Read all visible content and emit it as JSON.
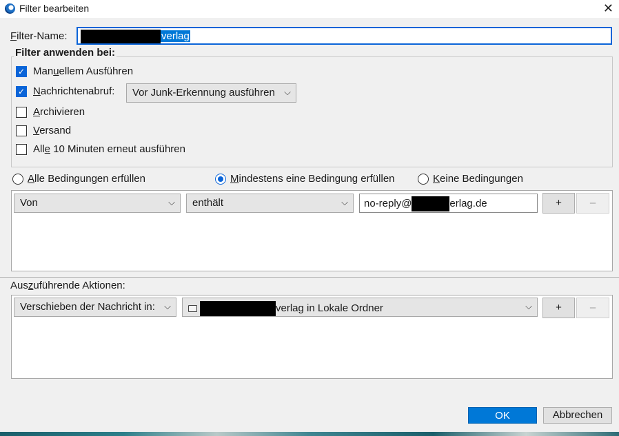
{
  "window": {
    "title": "Filter bearbeiten",
    "close_glyph": "✕"
  },
  "filter_name": {
    "label_prefix": "F",
    "label_rest": "ilter-Name:",
    "value_suffix": "verlag"
  },
  "apply_group": {
    "legend": "Filter anwenden bei:",
    "items": [
      {
        "pre": "Man",
        "acc": "u",
        "post": "ellem Ausführen",
        "checked": true
      },
      {
        "pre": "",
        "acc": "N",
        "post": "achrichtenabruf:",
        "checked": true
      },
      {
        "pre": "",
        "acc": "A",
        "post": "rchivieren",
        "checked": false
      },
      {
        "pre": "",
        "acc": "V",
        "post": "ersand",
        "checked": false
      },
      {
        "pre": "All",
        "acc": "e",
        "post": " 10 Minuten erneut ausführen",
        "checked": false
      }
    ],
    "junk_dropdown": "Vor Junk-Erkennung ausführen"
  },
  "match": {
    "options": [
      {
        "acc": "A",
        "rest": "lle Bedingungen erfüllen",
        "selected": false
      },
      {
        "acc": "M",
        "rest": "indestens eine Bedingung erfüllen",
        "selected": true
      },
      {
        "acc": "K",
        "rest": "eine Bedingungen",
        "selected": false
      }
    ]
  },
  "condition": {
    "field": "Von",
    "operator": "enthält",
    "value_prefix": "no-reply@",
    "value_suffix": "erlag.de",
    "add_label": "+",
    "remove_label": "–"
  },
  "actions": {
    "label_pre": "Aus",
    "label_acc": "z",
    "label_post": "uführende Aktionen:",
    "action": "Verschieben der Nachricht in:",
    "target_suffix": "verlag in Lokale Ordner",
    "add_label": "+",
    "remove_label": "–"
  },
  "footer": {
    "ok": "OK",
    "cancel": "Abbrechen"
  },
  "icons": {
    "app": "thunderbird-icon",
    "close": "close-icon",
    "chevron": "chevron-down-icon",
    "folder": "folder-icon"
  },
  "colors": {
    "accent": "#0078d7",
    "focus_border": "#0a64d8"
  }
}
